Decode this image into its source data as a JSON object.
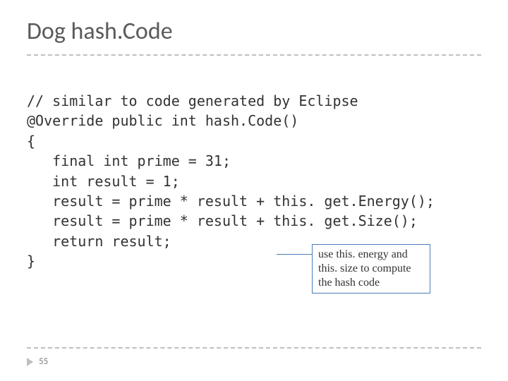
{
  "title": "Dog hash.Code",
  "code": {
    "l1": "// similar to code generated by Eclipse",
    "l2": "@Override public int hash.Code()",
    "l3": "{",
    "l4": "   final int prime = 31;",
    "l5": "   int result = 1;",
    "l6": "   result = prime * result + this. get.Energy();",
    "l7": "   result = prime * result + this. get.Size();",
    "l8": "   return result;",
    "l9": "}"
  },
  "callout": "use this. energy and this. size to compute the hash code",
  "page_number": "55"
}
